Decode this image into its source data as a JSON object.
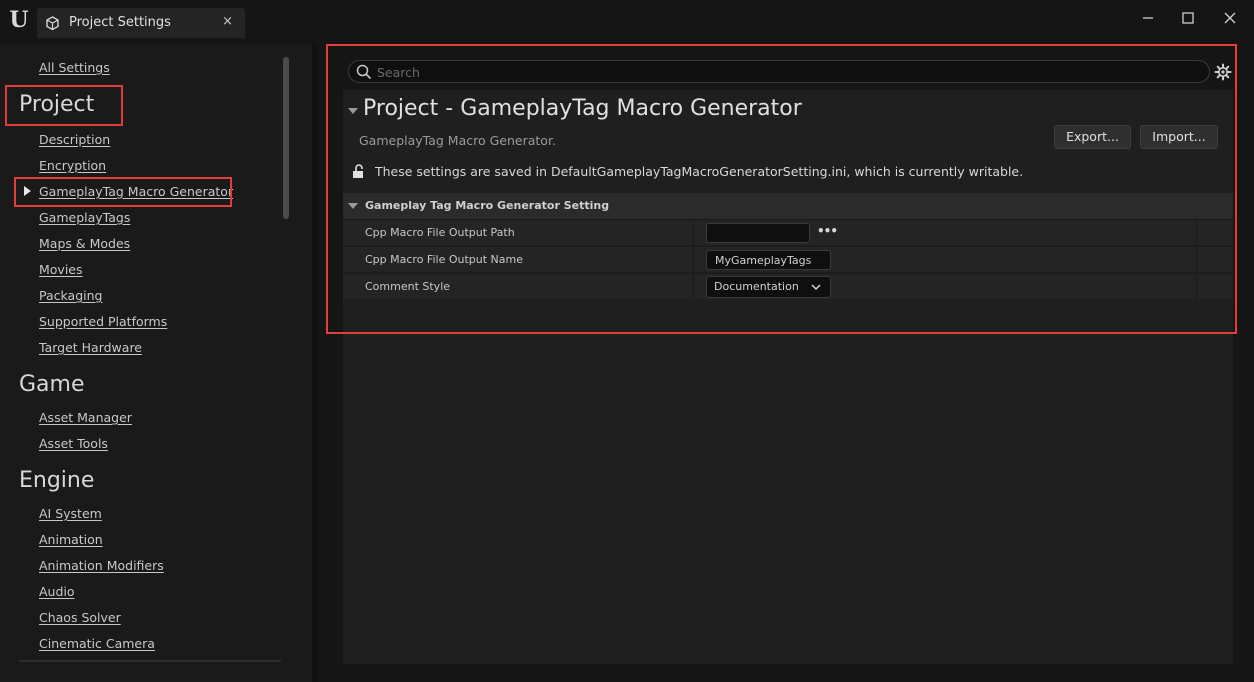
{
  "window": {
    "tab_title": "Project Settings",
    "close_glyph": "×",
    "logo_glyph": "U"
  },
  "sidebar": {
    "all_settings": "All Settings",
    "sections": [
      {
        "title": "Project",
        "items": [
          "Description",
          "Encryption",
          "GameplayTag Macro Generator",
          "GameplayTags",
          "Maps & Modes",
          "Movies",
          "Packaging",
          "Supported Platforms",
          "Target Hardware"
        ]
      },
      {
        "title": "Game",
        "items": [
          "Asset Manager",
          "Asset Tools"
        ]
      },
      {
        "title": "Engine",
        "items": [
          "AI System",
          "Animation",
          "Animation Modifiers",
          "Audio",
          "Chaos Solver",
          "Cinematic Camera"
        ]
      }
    ],
    "selected_item": "GameplayTag Macro Generator"
  },
  "main": {
    "search_placeholder": "Search",
    "title": "Project - GameplayTag Macro Generator",
    "description": "GameplayTag Macro Generator.",
    "export_label": "Export...",
    "import_label": "Import...",
    "saved_note": "These settings are saved in DefaultGameplayTagMacroGeneratorSetting.ini, which is currently writable.",
    "category": "Gameplay Tag Macro Generator Setting",
    "properties": [
      {
        "name": "Cpp Macro File Output Path",
        "value": ""
      },
      {
        "name": "Cpp Macro File Output Name",
        "value": "MyGameplayTags"
      },
      {
        "name": "Comment Style",
        "value": "Documentation"
      }
    ]
  },
  "colors": {
    "highlight": "#e23c3c",
    "background": "#151515",
    "panel": "#1f1f1f"
  },
  "icons": [
    "unreal-logo-icon",
    "project-settings-icon",
    "close-icon",
    "minimize-icon",
    "maximize-icon",
    "search-icon",
    "gear-icon",
    "lock-open-icon",
    "collapse-arrow-icon",
    "chevron-down-icon",
    "browse-dots-icon"
  ]
}
